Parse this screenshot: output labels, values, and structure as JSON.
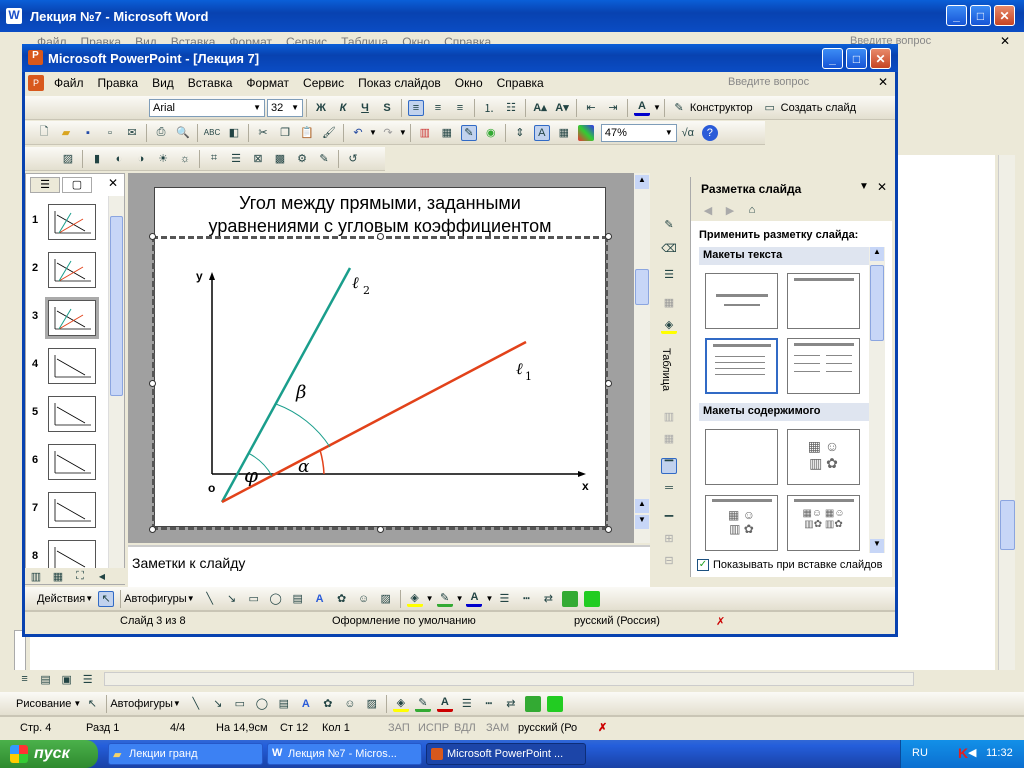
{
  "word": {
    "title": "Лекция №7 - Microsoft Word",
    "menu": [
      "Файл",
      "Правка",
      "Вид",
      "Вставка",
      "Формат",
      "Сервис",
      "Таблица",
      "Окно",
      "Справка"
    ],
    "help_placeholder": "Введите вопрос",
    "status": {
      "page": "Стр. 4",
      "section": "Разд 1",
      "pages": "4/4",
      "position": "На 14,9см",
      "line": "Ст 12",
      "col": "Кол 1",
      "rec": "ЗАП",
      "trk": "ИСПР",
      "ext": "ВДЛ",
      "ovr": "ЗАМ",
      "lang": "русский (Ро"
    },
    "drawing_label": "Рисование",
    "autoshapes_label": "Автофигуры"
  },
  "ppt": {
    "title": "Microsoft PowerPoint - [Лекция 7]",
    "menu": [
      "Файл",
      "Правка",
      "Вид",
      "Вставка",
      "Формат",
      "Сервис",
      "Показ слайдов",
      "Окно",
      "Справка"
    ],
    "help_placeholder": "Введите вопрос",
    "font": "Arial",
    "font_size": "32",
    "zoom": "47%",
    "designer_label": "Конструктор",
    "new_slide_label": "Создать слайд",
    "slide_title_line1": "Угол между прямыми, заданными",
    "slide_title_line2": "уравнениями с угловым коэффициентом",
    "notes_placeholder": "Заметки к слайду",
    "actions_label": "Действия",
    "autoshapes_label": "Автофигуры",
    "status": {
      "slide": "Слайд 3 из 8",
      "design": "Оформление по умолчанию",
      "lang": "русский (Россия)"
    },
    "slide_numbers": [
      "1",
      "2",
      "3",
      "4",
      "5",
      "6",
      "7",
      "8"
    ],
    "table_tab": "Таблица"
  },
  "graph": {
    "y": "y",
    "x": "x",
    "origin": "o",
    "l2": "ℓ",
    "l2sub": "2",
    "l1": "ℓ",
    "l1sub": "1",
    "beta": "β",
    "phi": "φ",
    "alpha": "α"
  },
  "task_pane": {
    "title": "Разметка слайда",
    "apply_label": "Применить разметку слайда:",
    "text_layouts": "Макеты текста",
    "content_layouts": "Макеты содержимого",
    "show_on_insert": "Показывать при вставке слайдов"
  },
  "taskbar": {
    "start": "пуск",
    "items": [
      "Лекции гранд",
      "Лекция №7 - Micros...",
      "Microsoft PowerPoint ..."
    ],
    "lang": "RU",
    "clock": "11:32"
  }
}
